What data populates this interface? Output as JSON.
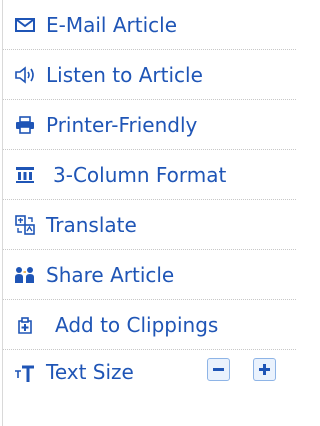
{
  "colors": {
    "link": "#1f55b6",
    "divider": "#c8c8c8",
    "button_border": "#8eb4e6",
    "button_bg": "#eaf2fd"
  },
  "actions": {
    "items": [
      {
        "label": "E-Mail Article",
        "icon": "envelope-icon"
      },
      {
        "label": "Listen to Article",
        "icon": "speaker-icon"
      },
      {
        "label": "Printer-Friendly",
        "icon": "printer-icon"
      },
      {
        "label": "3-Column Format",
        "icon": "columns-icon"
      },
      {
        "label": "Translate",
        "icon": "translate-icon"
      },
      {
        "label": "Share Article",
        "icon": "share-people-icon"
      },
      {
        "label": "Add to Clippings",
        "icon": "clippings-add-icon"
      },
      {
        "label": "Text Size",
        "icon": "text-size-icon"
      }
    ],
    "text_size": {
      "decrease_icon": "minus-icon",
      "increase_icon": "plus-icon"
    }
  }
}
